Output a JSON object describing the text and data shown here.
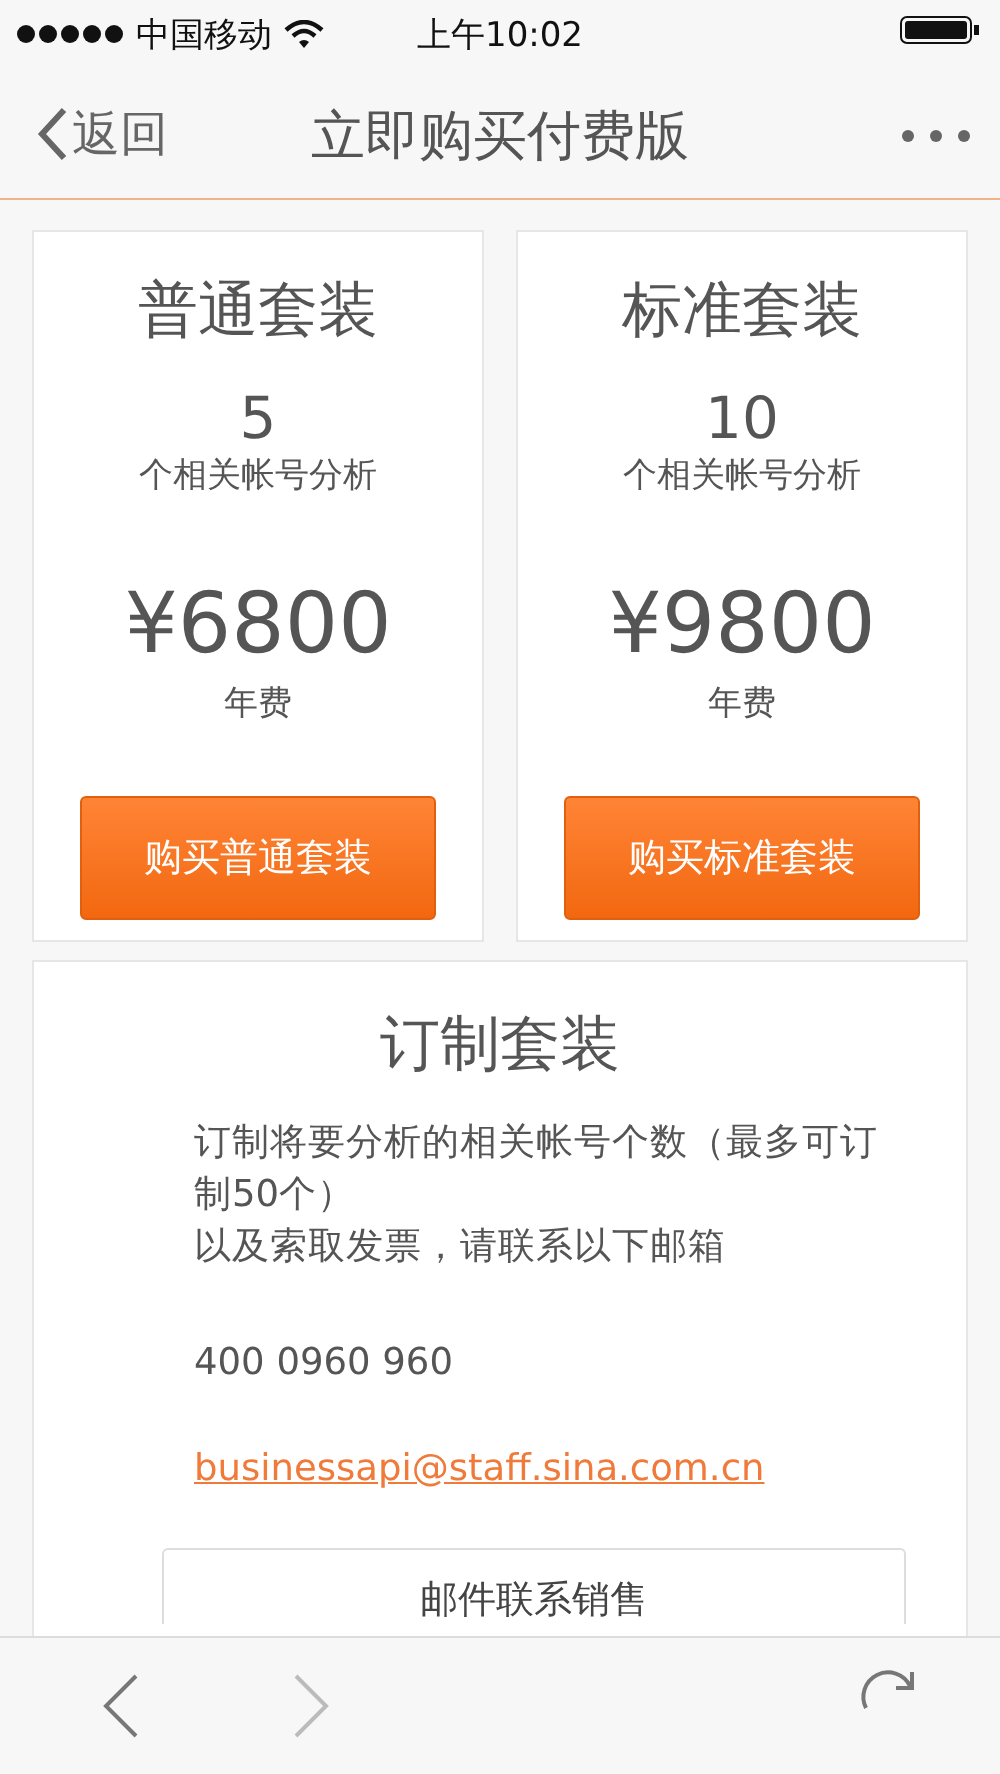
{
  "status_bar": {
    "carrier": "中国移动",
    "time": "上午10:02"
  },
  "nav_bar": {
    "back_label": "返回",
    "title": "立即购买付费版"
  },
  "plans": [
    {
      "title": "普通套装",
      "count": "5",
      "count_label": "个相关帐号分析",
      "price": "¥6800",
      "price_note": "年费",
      "button": "购买普通套装"
    },
    {
      "title": "标准套装",
      "count": "10",
      "count_label": "个相关帐号分析",
      "price": "¥9800",
      "price_note": "年费",
      "button": "购买标准套装"
    }
  ],
  "custom_plan": {
    "title": "订制套装",
    "description": [
      "订制将要分析的相关帐号个数（最多可订制50个）",
      "以及索取发票，请联系以下邮箱"
    ],
    "phone": "400 0960 960",
    "email": "businessapi@staff.sina.com.cn",
    "button": "邮件联系销售"
  },
  "toolbar": {
    "back": {
      "disabled": false
    },
    "forward": {
      "disabled": true
    }
  }
}
